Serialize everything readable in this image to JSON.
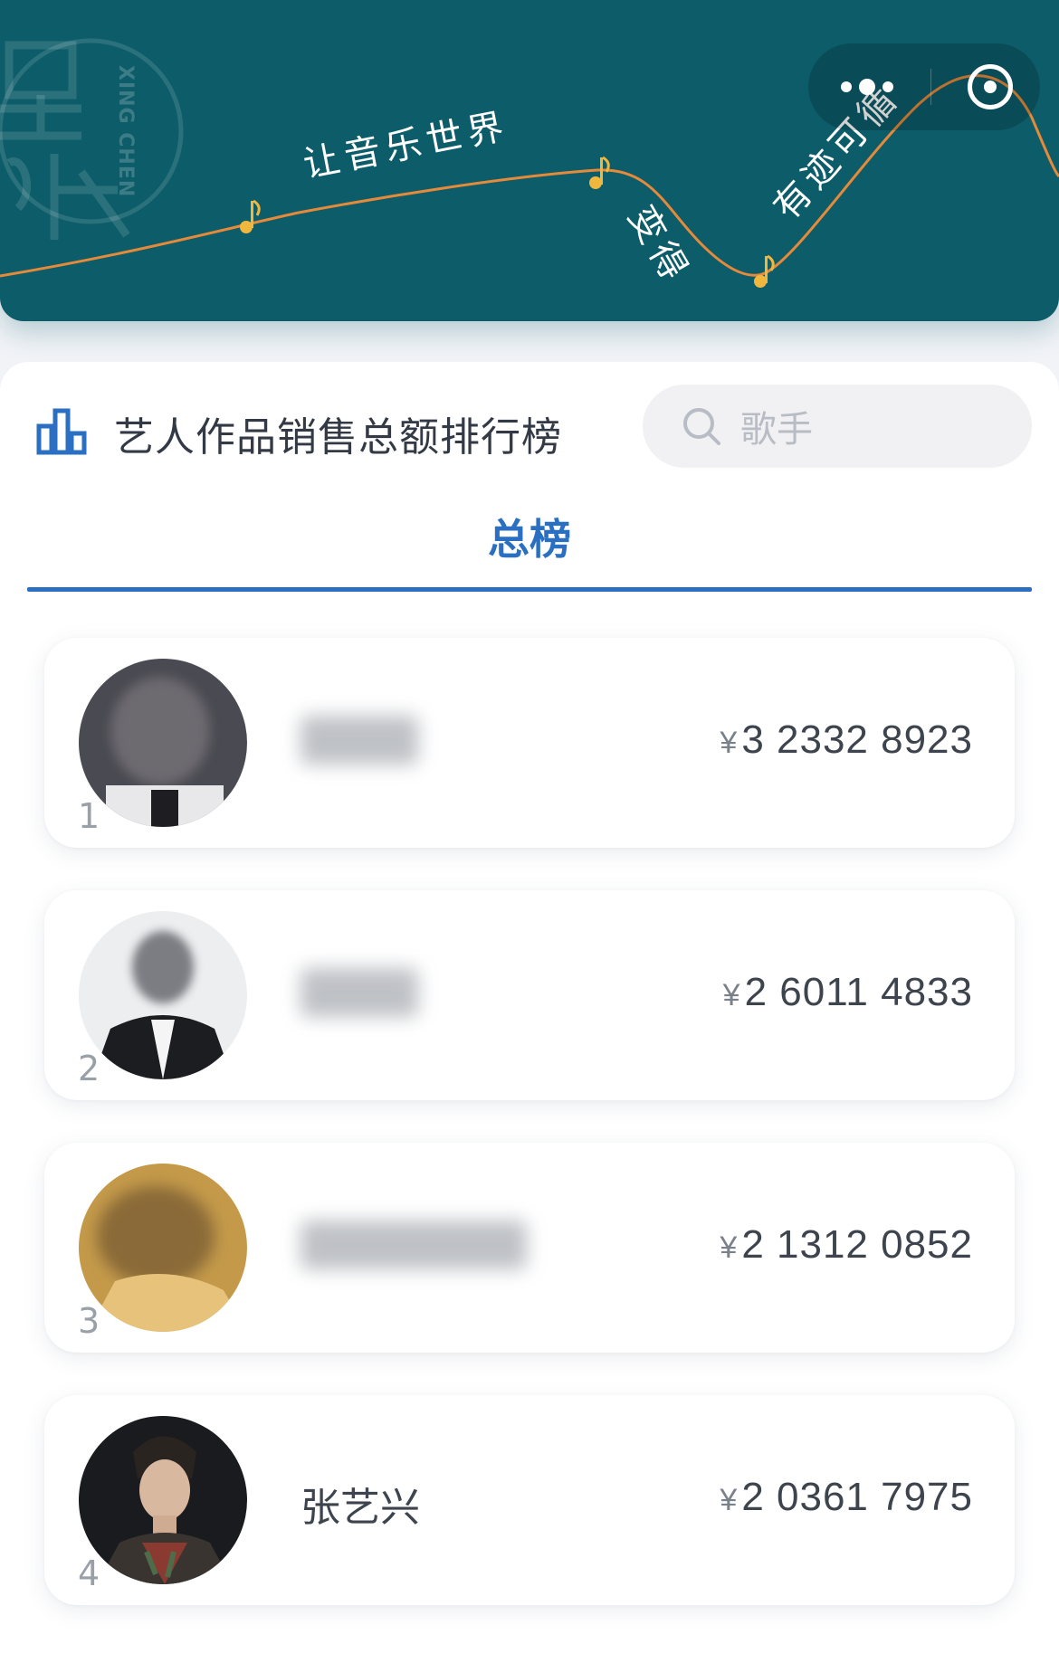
{
  "banner": {
    "logo_text": "XING CHEN",
    "slogan_part1": "让音乐世界",
    "slogan_part2": "变得",
    "slogan_part3": "有迹可循",
    "bg_color": "#0c5c69",
    "line_color": "#e58a3a",
    "note_color": "#f0b73e"
  },
  "capsule": {
    "more_icon": "more-dots-icon",
    "close_icon": "target-icon"
  },
  "ranking": {
    "title": "艺人作品销售总额排行榜",
    "title_icon": "bar-chart-icon",
    "search_placeholder": "歌手",
    "active_tab": "总榜",
    "accent_color": "#2a6fc2"
  },
  "artists": [
    {
      "rank": "1",
      "name": "",
      "currency": "¥",
      "amount": "3 2332 8923"
    },
    {
      "rank": "2",
      "name": "",
      "currency": "¥",
      "amount": "2 6011 4833"
    },
    {
      "rank": "3",
      "name": "",
      "currency": "¥",
      "amount": "2 1312 0852"
    },
    {
      "rank": "4",
      "name": "张艺兴",
      "currency": "¥",
      "amount": "2 0361 7975"
    }
  ]
}
